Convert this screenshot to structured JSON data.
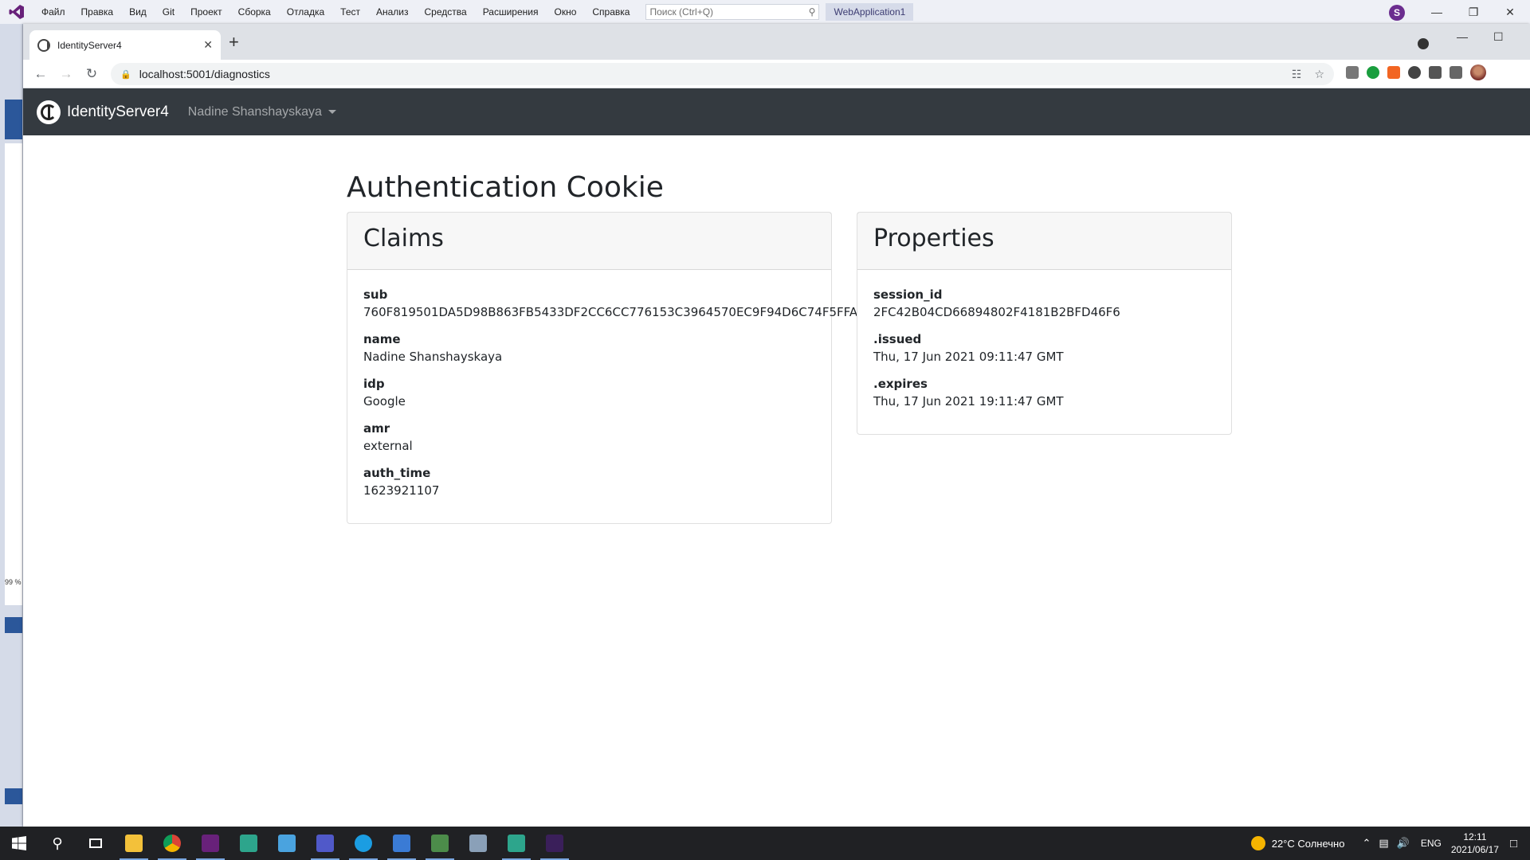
{
  "vs": {
    "menu": [
      "Файл",
      "Правка",
      "Вид",
      "Git",
      "Проект",
      "Сборка",
      "Отладка",
      "Тест",
      "Анализ",
      "Средства",
      "Расширения",
      "Окно",
      "Справка"
    ],
    "search_placeholder": "Поиск (Ctrl+Q)",
    "solution_name": "WebApplication1",
    "account_initial": "S",
    "sidebar_zoom": "99 %"
  },
  "browser": {
    "tab_title": "IdentityServer4",
    "url": "localhost:5001/diagnostics"
  },
  "site": {
    "brand": "IdentityServer4",
    "user_name": "Nadine Shanshayskaya"
  },
  "page": {
    "title": "Authentication Cookie",
    "claims": {
      "heading": "Claims",
      "items": [
        {
          "key": "sub",
          "value": "760F819501DA5D98B863FB5433DF2CC6CC776153C3964570EC9F94D6C74F5FFA"
        },
        {
          "key": "name",
          "value": "Nadine Shanshayskaya"
        },
        {
          "key": "idp",
          "value": "Google"
        },
        {
          "key": "amr",
          "value": "external"
        },
        {
          "key": "auth_time",
          "value": "1623921107"
        }
      ]
    },
    "properties": {
      "heading": "Properties",
      "items": [
        {
          "key": "session_id",
          "value": "2FC42B04CD66894802F4181B2BFD46F6"
        },
        {
          "key": ".issued",
          "value": "Thu, 17 Jun 2021 09:11:47 GMT"
        },
        {
          "key": ".expires",
          "value": "Thu, 17 Jun 2021 19:11:47 GMT"
        }
      ]
    }
  },
  "taskbar": {
    "weather": "22°C Солнечно",
    "language": "ENG",
    "time": "12:11",
    "date": "2021/06/17"
  },
  "colors": {
    "navbar": "#343a40",
    "taskbar": "#202124",
    "vs_accent": "#68217a"
  }
}
